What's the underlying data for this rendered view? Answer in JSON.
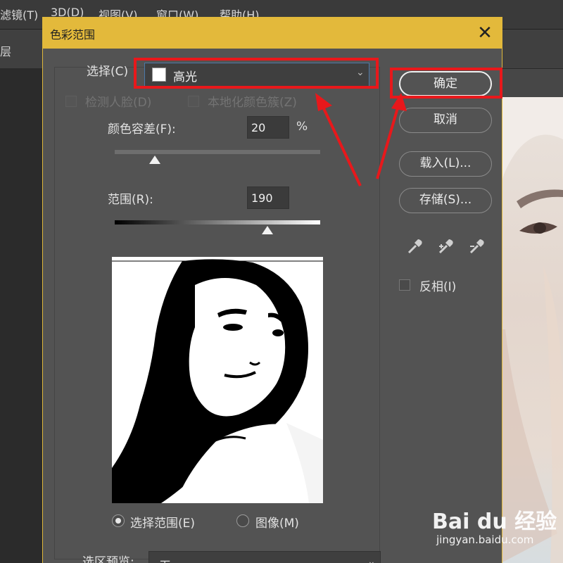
{
  "menubar": {
    "items": [
      "滤镜(T)",
      "3D(D)",
      "视图(V)",
      "窗口(W)",
      "帮助(H)"
    ]
  },
  "layers_panel": {
    "label": "层"
  },
  "dialog": {
    "title": "色彩范围",
    "select": {
      "label": "选择(C)",
      "value": "高光",
      "swatch_color": "#ffffff"
    },
    "detect_faces": {
      "label": "检测人脸(D)",
      "checked": false,
      "enabled": false
    },
    "localized_clusters": {
      "label": "本地化颜色簇(Z)",
      "checked": false,
      "enabled": false
    },
    "fuzziness": {
      "label": "颜色容差(F):",
      "value": "20",
      "unit": "%",
      "slider_fraction": 0.2
    },
    "range": {
      "label": "范围(R):",
      "value": "190",
      "slider_fraction": 0.745
    },
    "view_mode": {
      "options": [
        {
          "label": "选择范围(E)",
          "selected": true
        },
        {
          "label": "图像(M)",
          "selected": false
        }
      ]
    },
    "selection_preview": {
      "label": "选区预览:",
      "value": "无"
    },
    "buttons": {
      "ok": "确定",
      "cancel": "取消",
      "load": "载入(L)...",
      "save": "存储(S)..."
    },
    "eyedroppers": [
      "eyedropper-icon",
      "eyedropper-add-icon",
      "eyedropper-subtract-icon"
    ],
    "invert": {
      "label": "反相(I)",
      "checked": false
    }
  },
  "watermark": {
    "brand": "Bai du 经验",
    "url": "jingyan.baidu.com"
  },
  "colors": {
    "title_bar": "#e3b93b",
    "dialog_bg": "#535353",
    "annotation_red": "#e8181b",
    "dropdown_focus": "#4b78a8"
  }
}
